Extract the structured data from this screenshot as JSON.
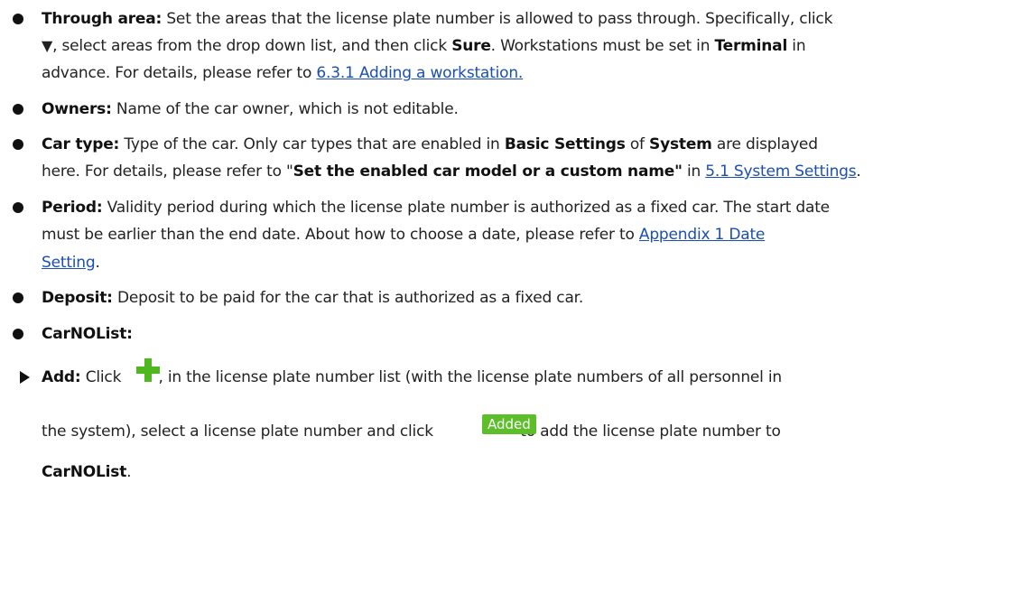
{
  "bullets": {
    "through_area": {
      "term": "Through area:",
      "l1": "Set the areas that the license plate number is allowed to pass through. Specifically, click",
      "l2_sym": "▼",
      "l2a": ", select areas from the drop down list, and then click ",
      "l2b": "Sure",
      "l2c": ". Workstations must be set in ",
      "l2d": "Terminal",
      "l2e": " in",
      "l3a": "advance. For details, please refer to ",
      "l3_link": "6.3.1 Adding a workstation."
    },
    "owners": {
      "term": "Owners:",
      "text": "Name of the car owner, which is not editable."
    },
    "car_type": {
      "term": "Car type:",
      "l1a": "Type of the car. Only car types that are enabled in ",
      "l1b": "Basic Settings",
      "l1c": " of ",
      "l1d": "System",
      "l1e": " are displayed",
      "l2a": "here. For details, please refer to \"",
      "l2b": "Set the enabled car model or a custom name\"",
      "l2c": " in ",
      "l2_link": "5.1 System Settings",
      "l2d": "."
    },
    "period": {
      "term": "Period:",
      "l1": "Validity period during which the license plate number is authorized as a fixed car. The start date",
      "l2a": "must be earlier than the end date. About how to choose a date, please refer to ",
      "l2_link": "Appendix 1 Date",
      "l3_link": "Setting",
      "l3a": "."
    },
    "deposit": {
      "term": "Deposit:",
      "text": "Deposit to be paid for the car that is authorized as a fixed car."
    },
    "carnolist": {
      "term": "CarNOList:"
    }
  },
  "sub": {
    "add": {
      "term": "Add:",
      "l1a": "Click ",
      "l1b": ", in the license plate number list (with the license plate numbers of all personnel in",
      "l2a": "the system), select a license plate number and click ",
      "added_label": "Added",
      "l2b": " to add the license plate number to",
      "l3": "CarNOList",
      "l3a": "."
    }
  },
  "icons": {
    "bullet": "black-circle-bullet",
    "sub_bullet": "arrow-bullet",
    "plus": "green-plus-icon"
  },
  "colors": {
    "link": "#1a4fb0",
    "green": "#5cbf2a"
  }
}
